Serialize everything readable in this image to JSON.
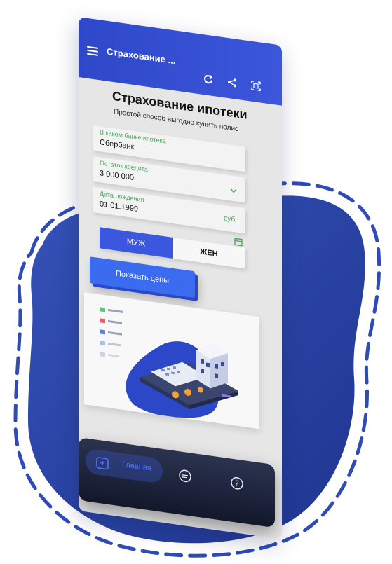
{
  "app": {
    "title": "Страхование ...",
    "heading": "Страхование ипотеки",
    "subheading": "Простой способ выгодно купить полис"
  },
  "topbar_icons": [
    "menu-icon",
    "refresh-icon",
    "share-icon",
    "qr-scan-icon"
  ],
  "form": {
    "bank": {
      "label": "В каком банке ипотека",
      "value": "Сбербанк"
    },
    "credit": {
      "label": "Остаток кредита",
      "value": "3 000 000",
      "suffix": "руб."
    },
    "birth": {
      "label": "Дата рождения",
      "value": "01.01.1999"
    },
    "gender": {
      "male": "МУЖ",
      "female": "ЖЕН",
      "selected": "male"
    },
    "submit": "Показать цены"
  },
  "nav": {
    "home_label": "Главная",
    "icons": [
      "home-icon",
      "chat-icon",
      "help-icon"
    ]
  },
  "colors": {
    "primary": "#3b57df",
    "accent_green": "#47a95c",
    "nav_bg": "#1b2138",
    "blob": "#2c48a8"
  }
}
